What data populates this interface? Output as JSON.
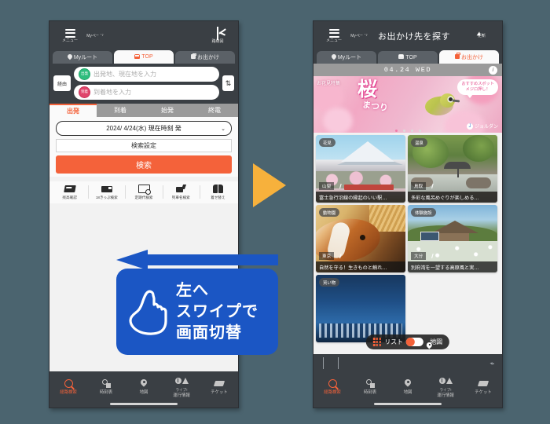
{
  "background_color": "#4b646f",
  "accent_color": "#f4623a",
  "callout_color": "#1b56c4",
  "arrow_color": "#f7b13c",
  "left_phone": {
    "header": {
      "menu_label": "メニュー",
      "mypage_label": "Myページ",
      "routemap_label": "路線図",
      "title": ""
    },
    "tabs": [
      {
        "label": "Myルート",
        "icon": "pin-icon",
        "active": false
      },
      {
        "label": "TOP",
        "icon": "train-icon",
        "active": true
      },
      {
        "label": "お出かけ",
        "icon": "bag-icon",
        "active": false
      }
    ],
    "route_input": {
      "via_label": "経由",
      "swap_label": "⇅",
      "departure_badge": "出発",
      "departure_placeholder": "出発地、現在地を入力",
      "arrival_badge": "到着",
      "arrival_placeholder": "到着地を入力"
    },
    "segment_tabs": [
      {
        "label": "出発",
        "active": true
      },
      {
        "label": "到着",
        "active": false
      },
      {
        "label": "始発",
        "active": false
      },
      {
        "label": "終電",
        "active": false
      }
    ],
    "date_selector": {
      "value": "2024/ 4/24(水) 現在時刻 発",
      "chevron": "⌄"
    },
    "search_setting_label": "検索設定",
    "search_button_label": "検索",
    "quick_links": [
      {
        "label": "残高確認",
        "icon": "ic-card-icon"
      },
      {
        "label": "18きっぷ検索",
        "icon": "ticket-icon"
      },
      {
        "label": "定期代検索",
        "icon": "pass-search-icon"
      },
      {
        "label": "列車名検索",
        "icon": "train-search-icon"
      },
      {
        "label": "着せ替え",
        "icon": "shirt-icon"
      }
    ],
    "bottom_nav": [
      {
        "label": "経路検索",
        "label2": "",
        "icon": "search-icon",
        "active": true
      },
      {
        "label": "時刻表",
        "label2": "",
        "icon": "timetable-icon",
        "active": false
      },
      {
        "label": "地図",
        "label2": "",
        "icon": "map-pin-icon",
        "active": false
      },
      {
        "label": "運行情報",
        "label2": "ライブ!",
        "icon": "live-info-icon",
        "active": false
      },
      {
        "label": "チケット",
        "label2": "",
        "icon": "ticket-icon",
        "active": false
      }
    ]
  },
  "right_phone": {
    "header": {
      "menu_label": "メニュー",
      "mypage_label": "Myページ",
      "refresh_label": "更新",
      "title": "お出かけ先を探す"
    },
    "tabs": [
      {
        "label": "Myルート",
        "icon": "pin-icon",
        "active": false
      },
      {
        "label": "TOP",
        "icon": "train-icon",
        "active": false
      },
      {
        "label": "お出かけ",
        "icon": "bag-icon",
        "active": true
      }
    ],
    "date_bar": {
      "date": "04.24 WED",
      "info_icon": "i"
    },
    "banner": {
      "badge": "お花見特集",
      "title": "桜",
      "subtitle": "まつり",
      "bubble_line1": "おすすめスポット",
      "bubble_line2": "メジロ押し！",
      "logo": "ジョルダン",
      "dots": 4,
      "active_dot": 1
    },
    "cards": [
      {
        "chip": "花見",
        "pref": "山梨",
        "title": "富士急行沿線の縁起のいい駅…",
        "scene": "fuji"
      },
      {
        "chip": "温泉",
        "pref": "鳥取",
        "title": "多彩な風呂めぐりが楽しめる…",
        "scene": "onsen"
      },
      {
        "chip": "動物園",
        "pref": "東京",
        "title": "自然を守る！生きものと触れ…",
        "scene": "pig"
      },
      {
        "chip": "体験施設",
        "pref": "大分",
        "title": "別府湾を一望する高原風と実…",
        "scene": "lodge"
      },
      {
        "chip": "買い物",
        "pref": "",
        "title": "",
        "scene": "shop"
      }
    ],
    "view_toggle": {
      "list_label": "リスト",
      "map_label": "地図",
      "selected": "list"
    },
    "browser_bar": {
      "back": "‹",
      "forward": "›",
      "reload": "⟳"
    },
    "bottom_nav": [
      {
        "label": "経路検索",
        "label2": "",
        "icon": "search-icon",
        "active": true
      },
      {
        "label": "時刻表",
        "label2": "",
        "icon": "timetable-icon",
        "active": false
      },
      {
        "label": "地図",
        "label2": "",
        "icon": "map-pin-icon",
        "active": false
      },
      {
        "label": "運行情報",
        "label2": "ライブ!",
        "icon": "live-info-icon",
        "active": false
      },
      {
        "label": "チケット",
        "label2": "",
        "icon": "ticket-icon",
        "active": false
      }
    ]
  },
  "annotation": {
    "line1": "左へ",
    "line2": "スワイプで",
    "line3": "画面切替",
    "hand_icon": "pointing-hand-icon",
    "arrow_direction": "left"
  }
}
